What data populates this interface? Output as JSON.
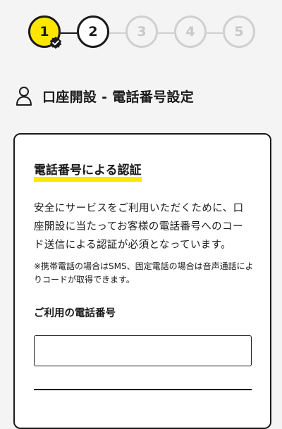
{
  "stepper": {
    "steps": [
      {
        "label": "1",
        "state": "completed"
      },
      {
        "label": "2",
        "state": "current"
      },
      {
        "label": "3",
        "state": "future"
      },
      {
        "label": "4",
        "state": "future"
      },
      {
        "label": "5",
        "state": "future"
      }
    ]
  },
  "header": {
    "title": "口座開設 - 電話番号設定",
    "icon": "person-icon"
  },
  "card": {
    "heading": "電話番号による認証",
    "description": "安全にサービスをご利用いただくために、口座開設に当たってお客様の電話番号へのコード送信による認証が必須となっています。",
    "note": "※携帯電話の場合はSMS、固定電話の場合は音声通話によりコードが取得できます。",
    "phone_label": "ご利用の電話番号",
    "phone_value": "",
    "phone_placeholder": ""
  },
  "colors": {
    "accent": "#ffe600",
    "text": "#1a1a1a",
    "inactive": "#d0d0d0",
    "background": "#f4f4f4"
  }
}
